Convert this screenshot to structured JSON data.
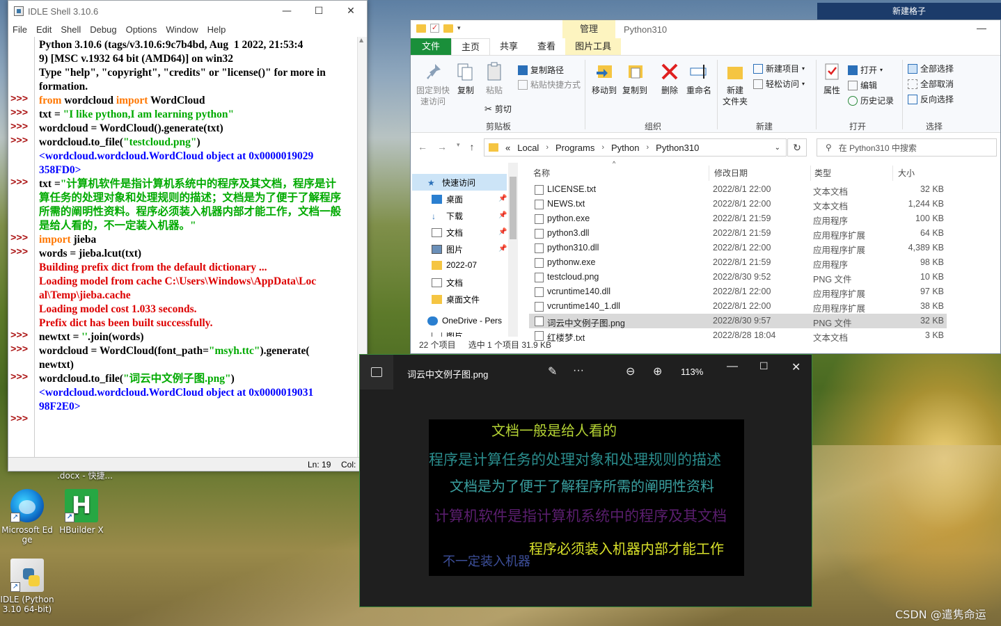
{
  "desktop": {
    "icons": [
      {
        "label_line1": "Microsoft Ed",
        "label_line2": "ge"
      },
      {
        "label_line1": "HBuilder X",
        "label_line2": ""
      },
      {
        "label_line1": "IDLE (Python",
        "label_line2": "3.10 64-bit)"
      }
    ],
    "partial_label": ".docx - 快捷...",
    "top_right_label": "新建格子",
    "watermark": "CSDN @遣隽命运"
  },
  "idle": {
    "title": "IDLE Shell 3.10.6",
    "menu": [
      "File",
      "Edit",
      "Shell",
      "Debug",
      "Options",
      "Window",
      "Help"
    ],
    "prompt": ">>>",
    "lines": {
      "l0": "Python 3.10.6 (tags/v3.10.6:9c7b4bd, Aug  1 2022, 21:53:4",
      "l1": "9) [MSC v.1932 64 bit (AMD64)] on win32",
      "l2": "Type \"help\", \"copyright\", \"credits\" or \"license()\" for more in",
      "l3": "formation.",
      "l4a": "from",
      "l4b": " wordcloud ",
      "l4c": "import",
      "l4d": " WordCloud",
      "l5a": "txt = ",
      "l5b": "\"I like python,I am learning python\"",
      "l6": "wordcloud = WordCloud().generate(txt)",
      "l7a": "wordcloud.to_file(",
      "l7b": "\"testcloud.png\"",
      "l7c": ")",
      "l8": "<wordcloud.wordcloud.WordCloud object at 0x0000019029",
      "l9": "358FD0>",
      "l10a": "txt =",
      "l10b": "\"计算机软件是指计算机系统中的程序及其文档，程序是计",
      "l11": "算任务的处理对象和处理规则的描述；文档是为了便于了解程序",
      "l12": "所需的阐明性资料。程序必须装入机器内部才能工作，文档一般",
      "l13": "是给人看的，不一定装入机器。\"",
      "l14a": "import",
      "l14b": " jieba",
      "l15": "words = jieba.lcut(txt)",
      "l16": "Building prefix dict from the default dictionary ...",
      "l17": "Loading model from cache C:\\Users\\Windows\\AppData\\Loc",
      "l18": "al\\Temp\\jieba.cache",
      "l19": "Loading model cost 1.033 seconds.",
      "l20": "Prefix dict has been built successfully.",
      "l21a": "newtxt = ",
      "l21b": "''",
      "l21c": ".join(words)",
      "l22a": "wordcloud = WordCloud(font_path=",
      "l22b": "\"msyh.ttc\"",
      "l22c": ").generate(",
      "l23": "newtxt)",
      "l24a": "wordcloud.to_file(",
      "l24b": "\"词云中文例子图.png\"",
      "l24c": ")",
      "l25": "<wordcloud.wordcloud.WordCloud object at 0x0000019031",
      "l26": "98F2E0>"
    },
    "status_ln": "Ln: 19",
    "status_col": "Col:"
  },
  "explorer": {
    "manage_tab": "管理",
    "title": "Python310",
    "tabs": [
      "文件",
      "主页",
      "共享",
      "查看",
      "图片工具"
    ],
    "ribbon": {
      "pin": [
        "固定到快",
        "速访问"
      ],
      "copy": "复制",
      "paste": "粘贴",
      "copy_path": "复制路径",
      "paste_shortcut": "粘贴快捷方式",
      "cut": "剪切",
      "clipboard": "剪贴板",
      "move_to": "移动到",
      "copy_to": "复制到",
      "delete": "删除",
      "rename": "重命名",
      "organize": "组织",
      "new_folder": [
        "新建",
        "文件夹"
      ],
      "new_item": "新建项目",
      "easy_access": "轻松访问",
      "new": "新建",
      "properties": "属性",
      "open": "打开",
      "edit": "编辑",
      "history": "历史记录",
      "open_group": "打开",
      "select_all": "全部选择",
      "select_none": "全部取消",
      "invert": "反向选择",
      "select_group": "选择"
    },
    "address": {
      "prefix": "«",
      "crumbs": [
        "Local",
        "Programs",
        "Python",
        "Python310"
      ]
    },
    "search_placeholder": "在 Python310 中搜索",
    "nav": [
      "快速访问",
      "桌面",
      "下载",
      "文档",
      "图片",
      "2022-07",
      "文档",
      "桌面文件",
      "OneDrive - Pers",
      "图片"
    ],
    "columns": {
      "name": "名称",
      "date": "修改日期",
      "type": "类型",
      "size": "大小"
    },
    "files": [
      {
        "name": "LICENSE.txt",
        "date": "2022/8/1 22:00",
        "type": "文本文档",
        "size": "32 KB"
      },
      {
        "name": "NEWS.txt",
        "date": "2022/8/1 22:00",
        "type": "文本文档",
        "size": "1,244 KB"
      },
      {
        "name": "python.exe",
        "date": "2022/8/1 21:59",
        "type": "应用程序",
        "size": "100 KB"
      },
      {
        "name": "python3.dll",
        "date": "2022/8/1 21:59",
        "type": "应用程序扩展",
        "size": "64 KB"
      },
      {
        "name": "python310.dll",
        "date": "2022/8/1 22:00",
        "type": "应用程序扩展",
        "size": "4,389 KB"
      },
      {
        "name": "pythonw.exe",
        "date": "2022/8/1 21:59",
        "type": "应用程序",
        "size": "98 KB"
      },
      {
        "name": "testcloud.png",
        "date": "2022/8/30 9:52",
        "type": "PNG 文件",
        "size": "10 KB"
      },
      {
        "name": "vcruntime140.dll",
        "date": "2022/8/1 22:00",
        "type": "应用程序扩展",
        "size": "97 KB"
      },
      {
        "name": "vcruntime140_1.dll",
        "date": "2022/8/1 22:00",
        "type": "应用程序扩展",
        "size": "38 KB"
      },
      {
        "name": "词云中文例子图.png",
        "date": "2022/8/30 9:57",
        "type": "PNG 文件",
        "size": "32 KB"
      },
      {
        "name": "红楼梦.txt",
        "date": "2022/8/28 18:04",
        "type": "文本文档",
        "size": "3 KB"
      }
    ],
    "status": {
      "count": "22 个项目",
      "selected": "选中 1 个项目  31.9 KB"
    }
  },
  "viewer": {
    "title": "词云中文例子图.png",
    "zoom": "113%",
    "words": [
      {
        "text": "文档一般是给人看的",
        "color": "#b5d334"
      },
      {
        "text": "程序是计算任务的处理对象和处理规则的描述",
        "color": "#2a8c8c"
      },
      {
        "text": "文档是为了便于了解程序所需的阐明性资料",
        "color": "#3aa0a0"
      },
      {
        "text": "计算机软件是指计算机系统中的程序及其文档",
        "color": "#5a1e6e"
      },
      {
        "text": "程序必须装入机器内部才能工作",
        "color": "#d8e02a"
      },
      {
        "text": "不一定装入机器",
        "color": "#3d4f9a"
      }
    ]
  }
}
